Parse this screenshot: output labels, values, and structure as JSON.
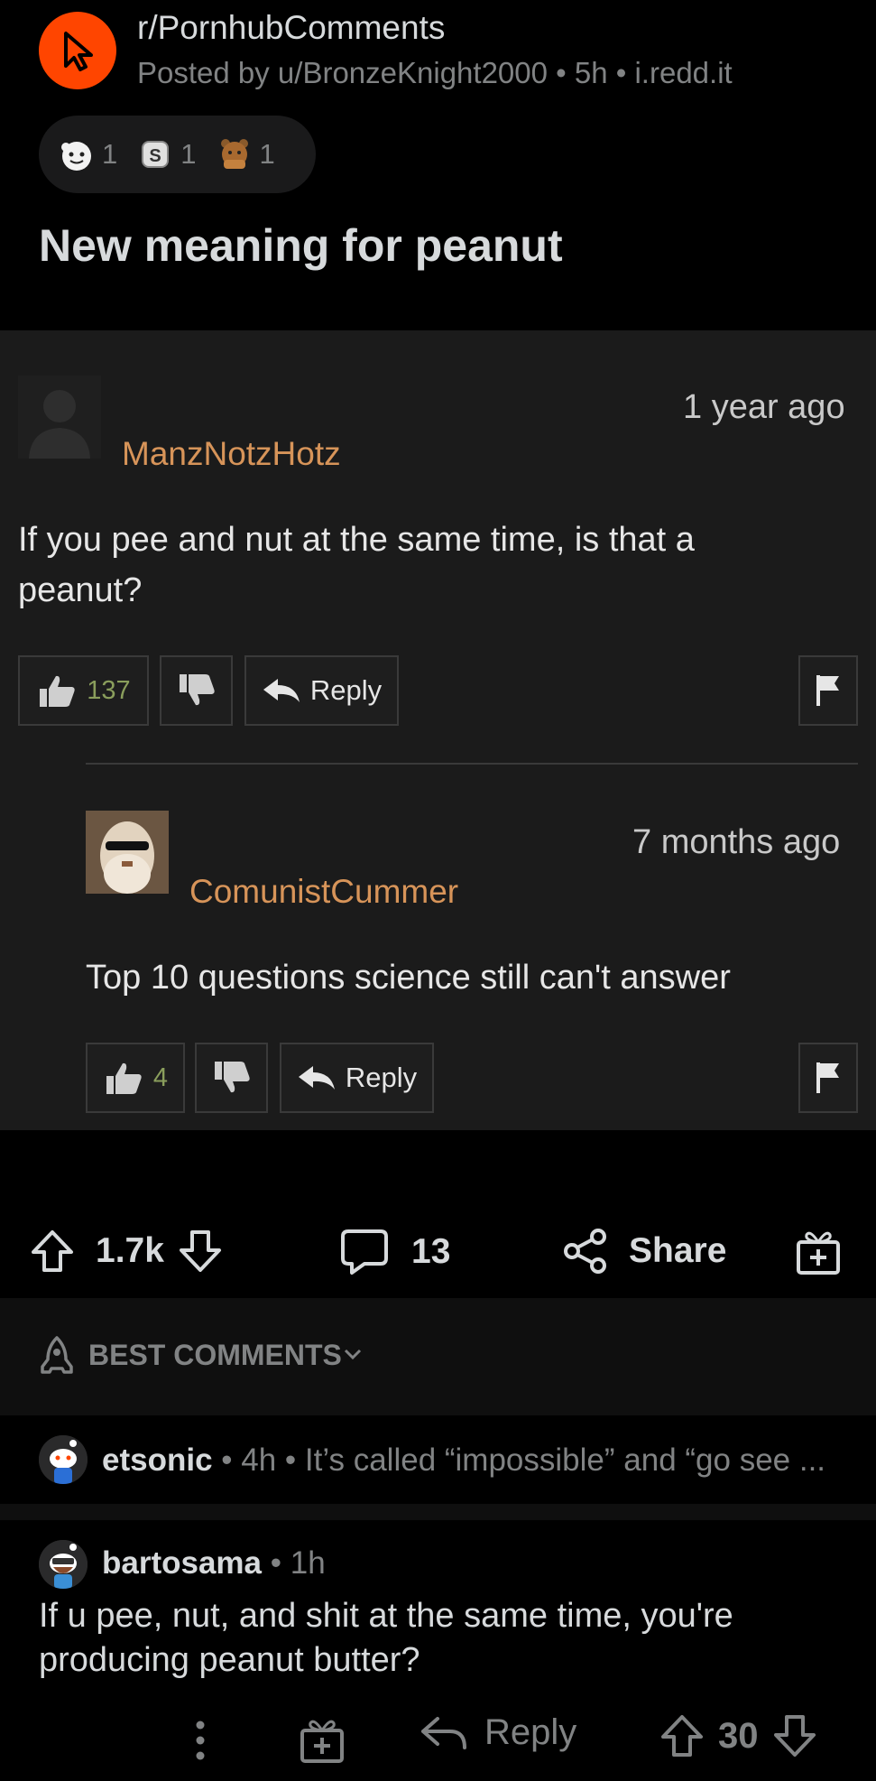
{
  "post": {
    "subreddit": "r/PornhubComments",
    "meta": "Posted by u/BronzeKnight2000 • 5h • i.redd.it",
    "awards": [
      {
        "icon": "wholesome-award-icon",
        "count": "1"
      },
      {
        "icon": "silver-award-icon",
        "count": "1"
      },
      {
        "icon": "bear-award-icon",
        "count": "1"
      }
    ],
    "title": "New meaning for peanut"
  },
  "embed": {
    "comment1": {
      "time": "1 year ago",
      "user": "ManzNotzHotz",
      "text": "If you pee and nut at the same time, is that a peanut?",
      "likes": "137",
      "reply_label": "Reply"
    },
    "comment2": {
      "time": "7 months ago",
      "user": "ComunistCummer",
      "text": "Top 10 questions science still can't answer",
      "likes": "4",
      "reply_label": "Reply"
    }
  },
  "actions": {
    "score": "1.7k",
    "comments": "13",
    "share_label": "Share"
  },
  "sort": {
    "label": "BEST COMMENTS"
  },
  "comments": [
    {
      "user": "etsonic",
      "sep": " • ",
      "age": "4h",
      "preview": "It’s called “impossible” and “go see ..."
    },
    {
      "user": "bartosama",
      "sep": " • ",
      "age": "1h",
      "text": "If u pee, nut, and shit at the same time, you're producing peanut butter?",
      "reply_label": "Reply",
      "score": "30"
    }
  ],
  "colors": {
    "accent": "#ff4500",
    "username_embed": "#d79459",
    "like_count": "#8a9e5c"
  }
}
